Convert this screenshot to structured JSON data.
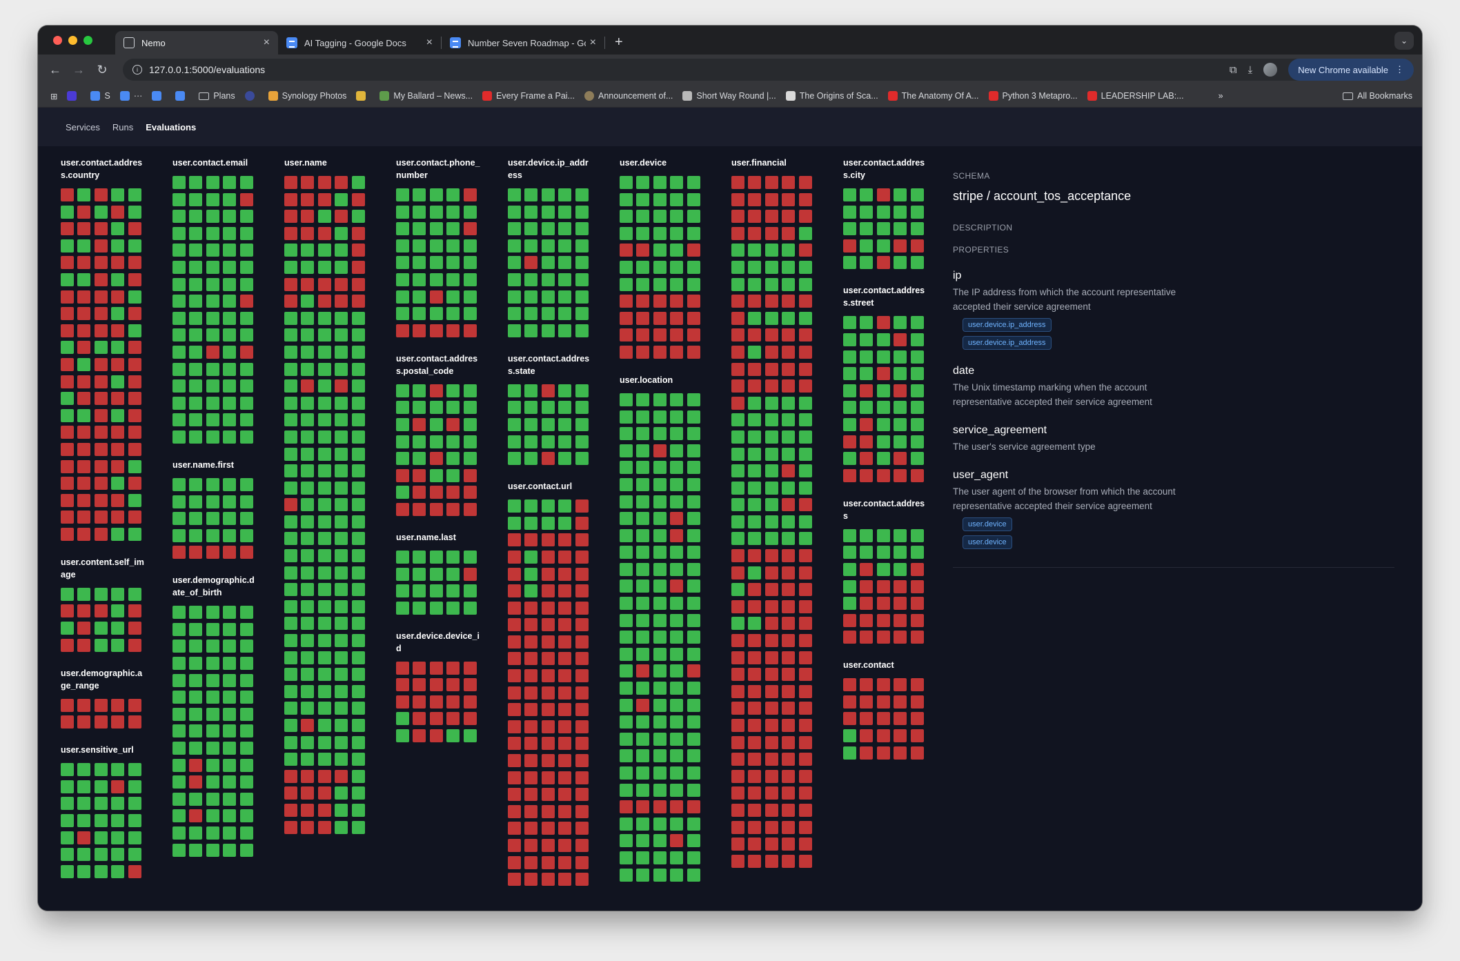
{
  "browser": {
    "tabs": [
      {
        "title": "Nemo",
        "icon": "nemo-icon",
        "active": true
      },
      {
        "title": "AI Tagging - Google Docs",
        "icon": "docs-icon",
        "active": false
      },
      {
        "title": "Number Seven Roadmap - Go",
        "icon": "docs-icon",
        "active": false
      }
    ],
    "url": "127.0.0.1:5000/evaluations",
    "update_label": "New Chrome available",
    "bookmarks": [
      "S",
      "Plans",
      "Synology Photos",
      "My Ballard – News...",
      "Every Frame a Pai...",
      "Announcement of...",
      "Short Way Round |...",
      "The Origins of Sca...",
      "The Anatomy Of A...",
      "Python 3 Metapro...",
      "LEADERSHIP LAB:..."
    ],
    "all_bookmarks": "All Bookmarks"
  },
  "nav": {
    "items": [
      "Services",
      "Runs",
      "Evaluations"
    ],
    "active": "Evaluations"
  },
  "colors": {
    "pass": "#3db84e",
    "fail": "#c23636",
    "background": "#111420"
  },
  "columns": [
    {
      "groups": [
        {
          "name": "user.contact.address.country",
          "rows": [
            "FGFGG",
            "GFGFG",
            "FFFGF",
            "GGFGG",
            "FFFFF",
            "GGFGF",
            "FFFFG",
            "FFFGF",
            "FFFFG",
            "GFGGF",
            "FGFFF",
            "FFFGF",
            "GFFFF",
            "GGFGF",
            "FFFFF",
            "FFFFF",
            "FFFFG",
            "FFFGF",
            "FFFFG",
            "FFFFF",
            "FFFGG"
          ]
        },
        {
          "name": "user.content.self_image",
          "rows": [
            "GGGGG",
            "FFFGF",
            "GFGGF",
            "FFGGF"
          ]
        },
        {
          "name": "user.demographic.age_range",
          "rows": [
            "FFFFF",
            "FFFFF"
          ]
        },
        {
          "name": "user.sensitive_url",
          "rows": [
            "GGGGG",
            "GGGFG",
            "GGGGG",
            "GGGGG",
            "GFGGG",
            "GGGGG",
            "GGGGF"
          ]
        }
      ]
    },
    {
      "groups": [
        {
          "name": "user.contact.email",
          "rows": [
            "GGGGG",
            "GGGGF",
            "GGGGG",
            "GGGGG",
            "GGGGG",
            "GGGGG",
            "GGGGG",
            "GGGGF",
            "GGGGG",
            "GGGGG",
            "GGFGF",
            "GGGGG",
            "GGGGG",
            "GGGGG",
            "GGGGG",
            "GGGGG"
          ]
        },
        {
          "name": "user.name.first",
          "rows": [
            "GGGGG",
            "GGGGG",
            "GGGGG",
            "GGGGG",
            "FFFFF"
          ]
        },
        {
          "name": "user.demographic.date_of_birth",
          "rows": [
            "GGGGG",
            "GGGGG",
            "GGGGG",
            "GGGGG",
            "GGGGG",
            "GGGGG",
            "GGGGG",
            "GGGGG",
            "GGGGG",
            "GFGGG",
            "GFGGG",
            "GGGGG",
            "GFGGG",
            "GGGGG",
            "GGGGG"
          ]
        }
      ]
    },
    {
      "groups": [
        {
          "name": "user.name",
          "rows": [
            "FFFFG",
            "FFFGF",
            "FFGFG",
            "FFFGF",
            "GGGGF",
            "GGGGF",
            "FFFFF",
            "FGFFF",
            "GGGGG",
            "GGGGG",
            "GGGGG",
            "GGGGG",
            "GFGFG",
            "GGGGG",
            "GGGGG",
            "GGGGG",
            "GGGGG",
            "GGGGG",
            "GGGGG",
            "FGGGG",
            "GGGGG",
            "GGGGG",
            "GGGGG",
            "GGGGG",
            "GGGGG",
            "GGGGG",
            "GGGGG",
            "GGGGG",
            "GGGGG",
            "GGGGG",
            "GGGGG",
            "GGGGG",
            "GFGGG",
            "GGGGG",
            "GGGGG",
            "FFFFG",
            "FFFGG",
            "FFFGG",
            "FFFGG"
          ]
        }
      ]
    },
    {
      "groups": [
        {
          "name": "user.contact.phone_number",
          "rows": [
            "GGGGF",
            "GGGGG",
            "GGGGF",
            "GGGGG",
            "GGGGG",
            "GGGGG",
            "GGFGG",
            "GGGGG",
            "FFFFF"
          ]
        },
        {
          "name": "user.contact.address.postal_code",
          "rows": [
            "GGFGG",
            "GGGGG",
            "GFGFG",
            "GGGGG",
            "GGFGG",
            "FFGGF",
            "GFFFF",
            "FFFFF"
          ]
        },
        {
          "name": "user.name.last",
          "rows": [
            "GGGGG",
            "GGGGF",
            "GGGGG",
            "GGGGG"
          ]
        },
        {
          "name": "user.device.device_id",
          "rows": [
            "FFFFF",
            "FFFFF",
            "FFFFF",
            "GFFFF",
            "GFFGG"
          ]
        }
      ]
    },
    {
      "groups": [
        {
          "name": "user.device.ip_address",
          "rows": [
            "GGGGG",
            "GGGGG",
            "GGGGG",
            "GGGGG",
            "GFGGG",
            "GGGGG",
            "GGGGG",
            "GGGGG",
            "GGGGG"
          ]
        },
        {
          "name": "user.contact.address.state",
          "rows": [
            "GGFGG",
            "GGGGG",
            "GGGGG",
            "GGGGG",
            "GGFGG"
          ]
        },
        {
          "name": "user.contact.url",
          "rows": [
            "GGGGF",
            "GGGGF",
            "FFFFF",
            "FGFFF",
            "FGFFF",
            "FGFFF",
            "FFFFF",
            "FFFFF",
            "FFFFF",
            "FFFFF",
            "FFFFF",
            "FFFFF",
            "FFFFF",
            "FFFFF",
            "FFFFF",
            "FFFFF",
            "FFFFF",
            "FFFFF",
            "FFFFF",
            "FFFFF",
            "FFFFF",
            "FFFFF",
            "FFFFF"
          ]
        }
      ]
    },
    {
      "groups": [
        {
          "name": "user.device",
          "rows": [
            "GGGGG",
            "GGGGG",
            "GGGGG",
            "GGGGG",
            "FFGGF",
            "GGGGG",
            "GGGGG",
            "FFFFF",
            "FFFFF",
            "FFFFF",
            "FFFFF"
          ]
        },
        {
          "name": "user.location",
          "rows": [
            "GGGGG",
            "GGGGG",
            "GGGGG",
            "GGFGG",
            "GGGGG",
            "GGGGG",
            "GGGGG",
            "GGGFG",
            "GGGFG",
            "GGGGG",
            "GGGGG",
            "GGGFG",
            "GGGGG",
            "GGGGG",
            "GGGGG",
            "GGGGG",
            "GFGGF",
            "GGGGG",
            "GFGGG",
            "GGGGG",
            "GGGGG",
            "GGGGG",
            "GGGGG",
            "GGGGG",
            "FFFFF",
            "GGGGG",
            "GGGFG",
            "GGGGG",
            "GGGGG"
          ]
        }
      ]
    },
    {
      "groups": [
        {
          "name": "user.financial",
          "rows": [
            "FFFFF",
            "FFFFF",
            "FFFFF",
            "FFFFG",
            "GGGGF",
            "GGGGG",
            "GGGGG",
            "FFFFF",
            "FGGGG",
            "FFFFF",
            "FGFFF",
            "FFFFF",
            "FFFFF",
            "FGGGG",
            "GGGGG",
            "GGGGG",
            "GGGGG",
            "GGGFG",
            "GGGGG",
            "GGGFF",
            "GGGGG",
            "GGGGG",
            "FFFFF",
            "FGFFF",
            "GFFFF",
            "FFFFF",
            "GGFFF",
            "FFFFF",
            "FFFFF",
            "FFFFF",
            "FFFFF",
            "FFFFF",
            "FFFFF",
            "FFFFF",
            "FFFFF",
            "FFFFF",
            "FFFFF",
            "FFFFF",
            "FFFFF",
            "FFFFF",
            "FFFFF"
          ]
        }
      ]
    },
    {
      "groups": [
        {
          "name": "user.contact.address.city",
          "rows": [
            "GGFGG",
            "GGGGG",
            "GGGGG",
            "FGGFF",
            "GGFGG"
          ]
        },
        {
          "name": "user.contact.address.street",
          "rows": [
            "GGFGG",
            "GGGFG",
            "GGGGG",
            "GGFGG",
            "GFGFG",
            "GGGGG",
            "GFGGG",
            "FFGGG",
            "GFGFG",
            "FFFFF"
          ]
        },
        {
          "name": "user.contact.address",
          "rows": [
            "GGGGG",
            "GGGGG",
            "GFGGF",
            "GFFFF",
            "GFFFF",
            "FFFFF",
            "FFFFF"
          ]
        },
        {
          "name": "user.contact",
          "rows": [
            "FFFFF",
            "FFFFF",
            "FFFFF",
            "GFFFF",
            "GFFFF"
          ]
        }
      ]
    }
  ],
  "schema": {
    "schema_label": "SCHEMA",
    "title": "stripe / account_tos_acceptance",
    "description_label": "DESCRIPTION",
    "properties_label": "PROPERTIES",
    "properties": [
      {
        "name": "ip",
        "description": "The IP address from which the account representative accepted their service agreement",
        "tags": [
          "user.device.ip_address",
          "user.device.ip_address"
        ]
      },
      {
        "name": "date",
        "description": "The Unix timestamp marking when the account representative accepted their service agreement",
        "tags": []
      },
      {
        "name": "service_agreement",
        "description": "The user's service agreement type",
        "tags": []
      },
      {
        "name": "user_agent",
        "description": "The user agent of the browser from which the account representative accepted their service agreement",
        "tags": [
          "user.device",
          "user.device"
        ]
      }
    ]
  }
}
